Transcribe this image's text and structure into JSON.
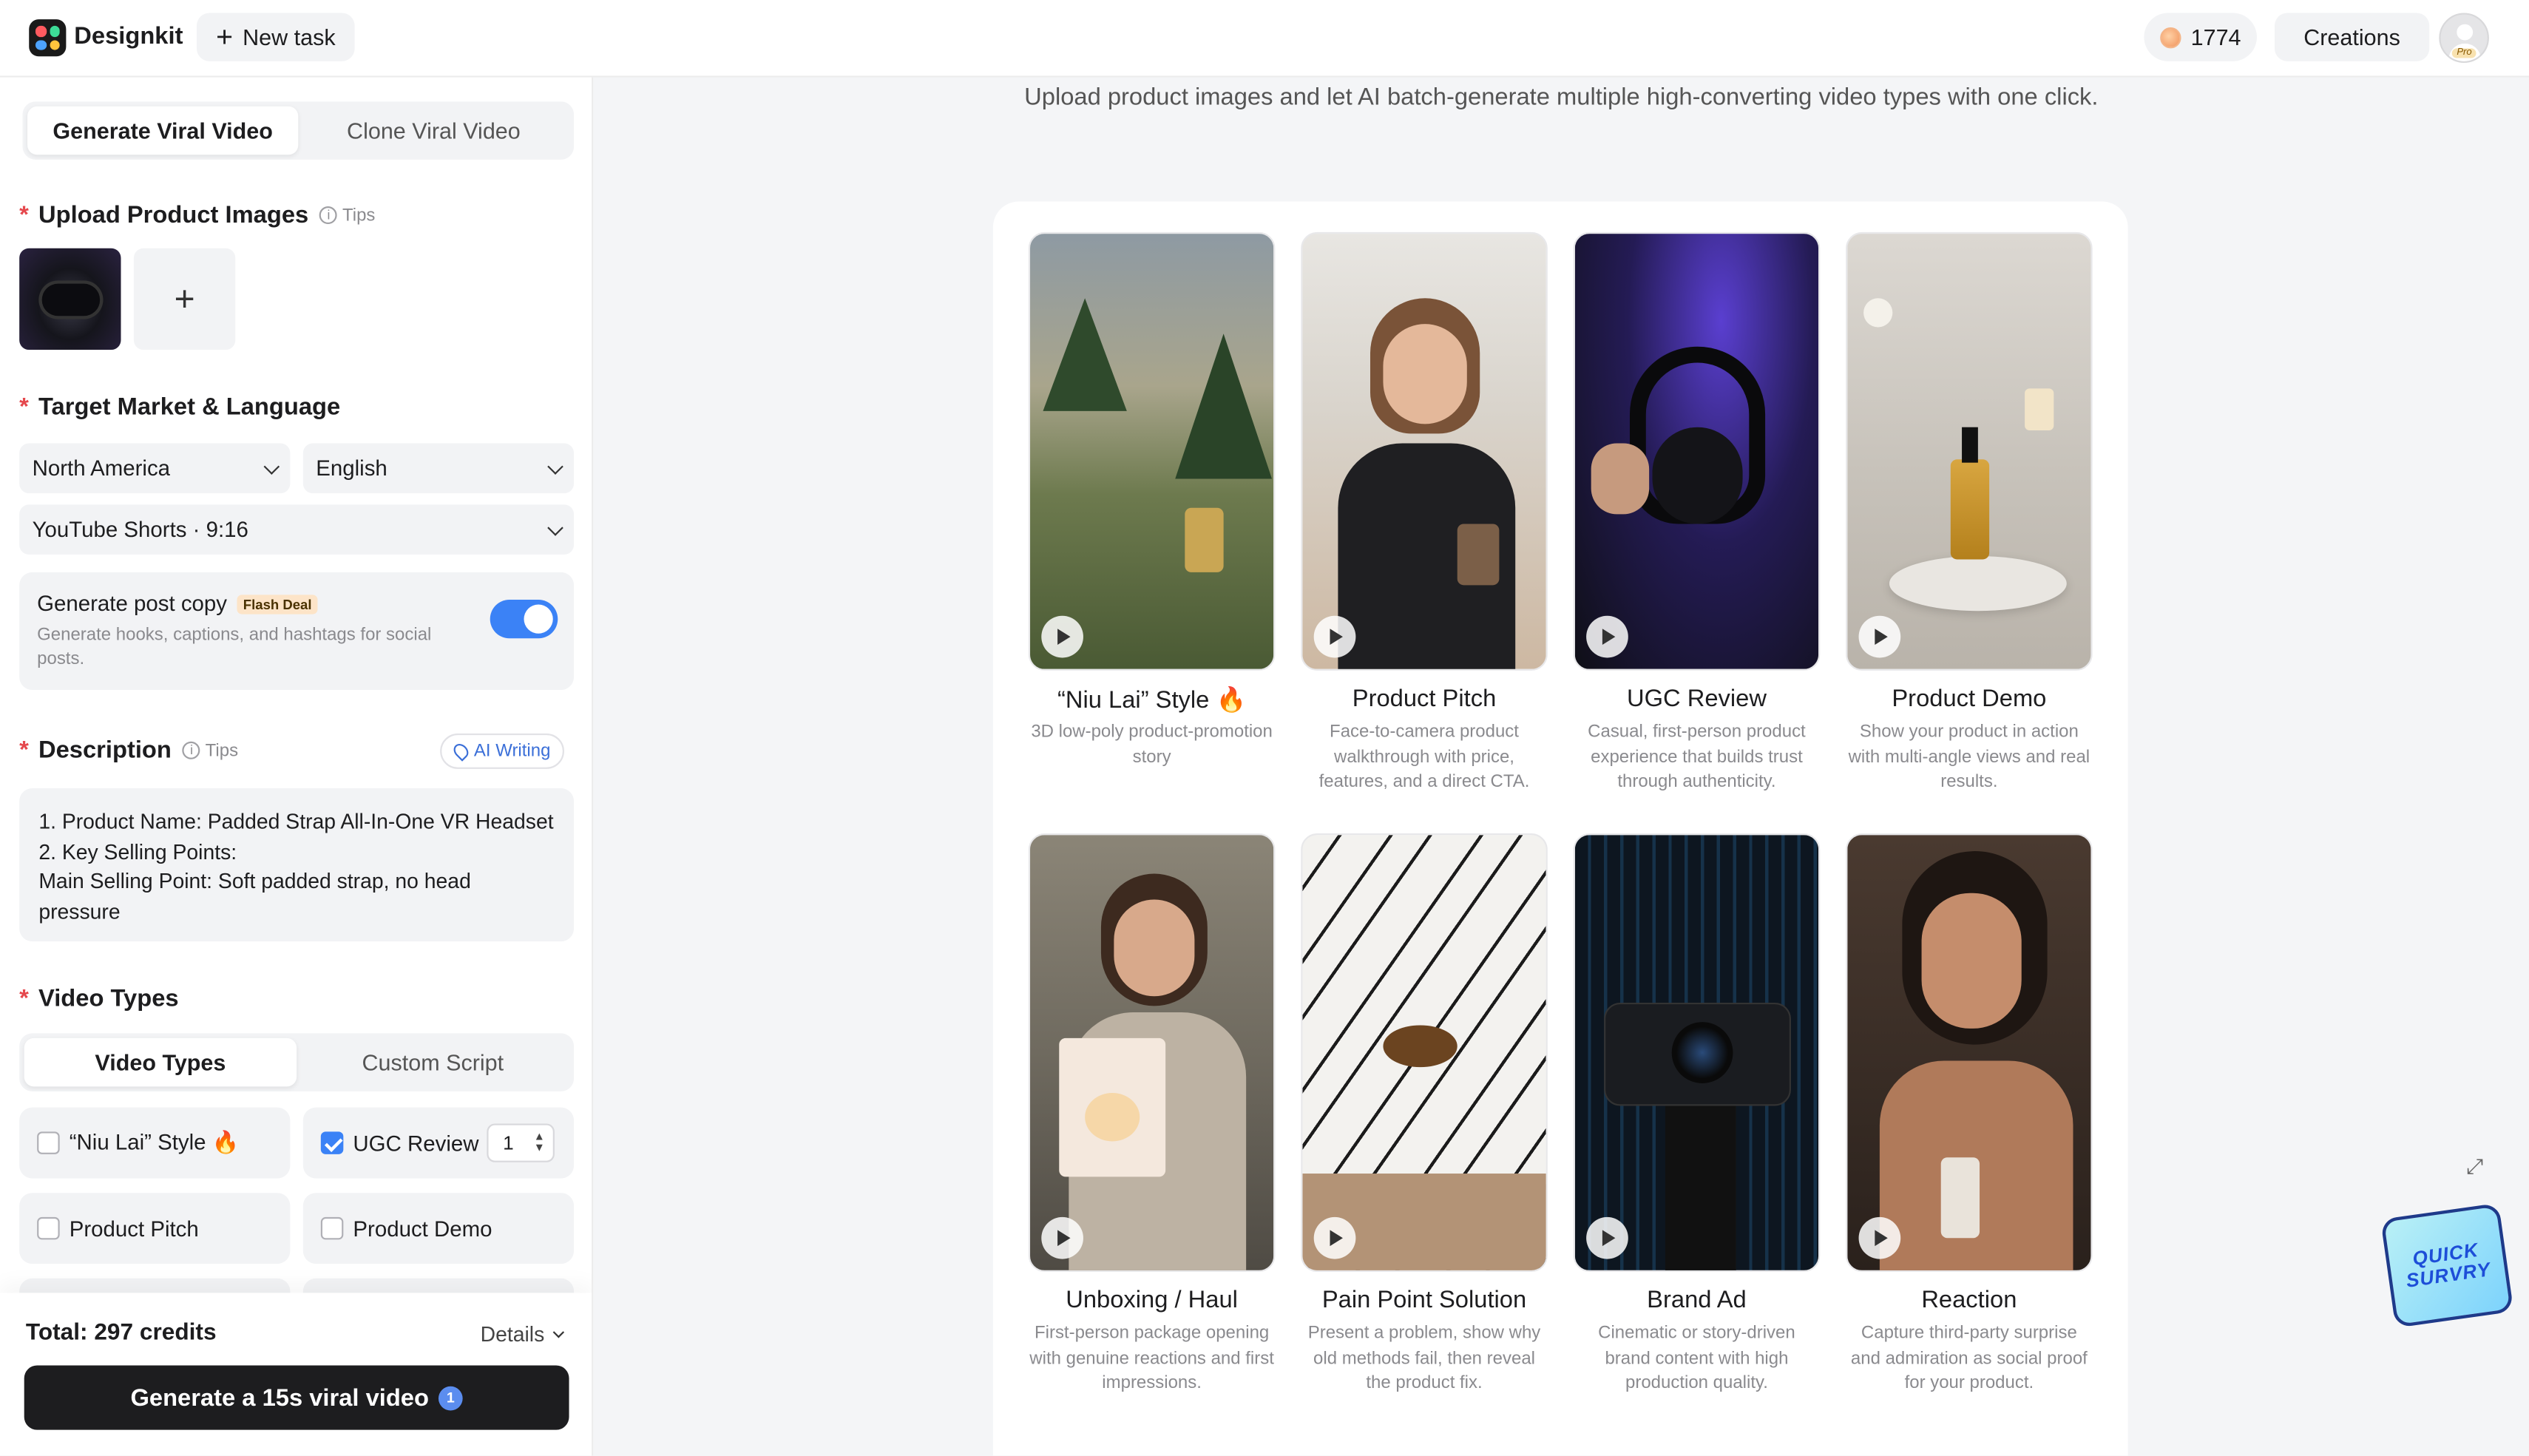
{
  "header": {
    "brand": "Designkit",
    "new_task": "New task",
    "credits": "1774",
    "creations": "Creations",
    "avatar_badge": "Pro"
  },
  "sidebar": {
    "mode_tabs": [
      "Generate Viral Video",
      "Clone Viral Video"
    ],
    "upload_title": "Upload Product Images",
    "tips": "Tips",
    "market_title": "Target Market & Language",
    "market": "North America",
    "language": "English",
    "platform": "YouTube Shorts · 9:16",
    "post_copy_title": "Generate post copy",
    "post_copy_badge": "Flash Deal",
    "post_copy_desc": "Generate hooks, captions, and hashtags for social posts.",
    "post_copy_enabled": true,
    "description_title": "Description",
    "ai_writing": "AI Writing",
    "description_lines": [
      "1. Product Name: Padded Strap All-In-One VR Headset",
      "2. Key Selling Points:",
      "Main Selling Point: Soft padded strap, no head pressure"
    ],
    "video_types_title": "Video Types",
    "vt_tabs": [
      "Video Types",
      "Custom Script"
    ],
    "options": [
      {
        "label": "“Niu Lai” Style 🔥",
        "checked": false
      },
      {
        "label": "UGC Review",
        "checked": true
      },
      {
        "label": "Product Pitch",
        "checked": false
      },
      {
        "label": "Product Demo",
        "checked": false
      }
    ],
    "ugc_qty": "1",
    "total": "Total: 297 credits",
    "details": "Details",
    "generate": "Generate a 15s viral video",
    "generate_badge": "1"
  },
  "main": {
    "subtitle": "Upload product images and let AI batch-generate multiple high-converting video types with one click.",
    "tiles": [
      {
        "name": "“Niu Lai” Style 🔥",
        "desc": "3D low-poly product-promotion story"
      },
      {
        "name": "Product Pitch",
        "desc": "Face-to-camera product walkthrough with price, features, and a direct CTA."
      },
      {
        "name": "UGC Review",
        "desc": "Casual, first-person product experience that builds trust through authenticity."
      },
      {
        "name": "Product Demo",
        "desc": "Show your product in action with multi-angle views and real results."
      },
      {
        "name": "Unboxing / Haul",
        "desc": "First-person package opening with genuine reactions and first impressions."
      },
      {
        "name": "Pain Point Solution",
        "desc": "Present a problem, show why old methods fail, then reveal the product fix."
      },
      {
        "name": "Brand Ad",
        "desc": "Cinematic or story-driven brand content with high production quality."
      },
      {
        "name": "Reaction",
        "desc": "Capture third-party surprise and admiration as social proof for your product."
      }
    ],
    "survey_line1": "QUICK",
    "survey_line2": "SURVRY"
  }
}
